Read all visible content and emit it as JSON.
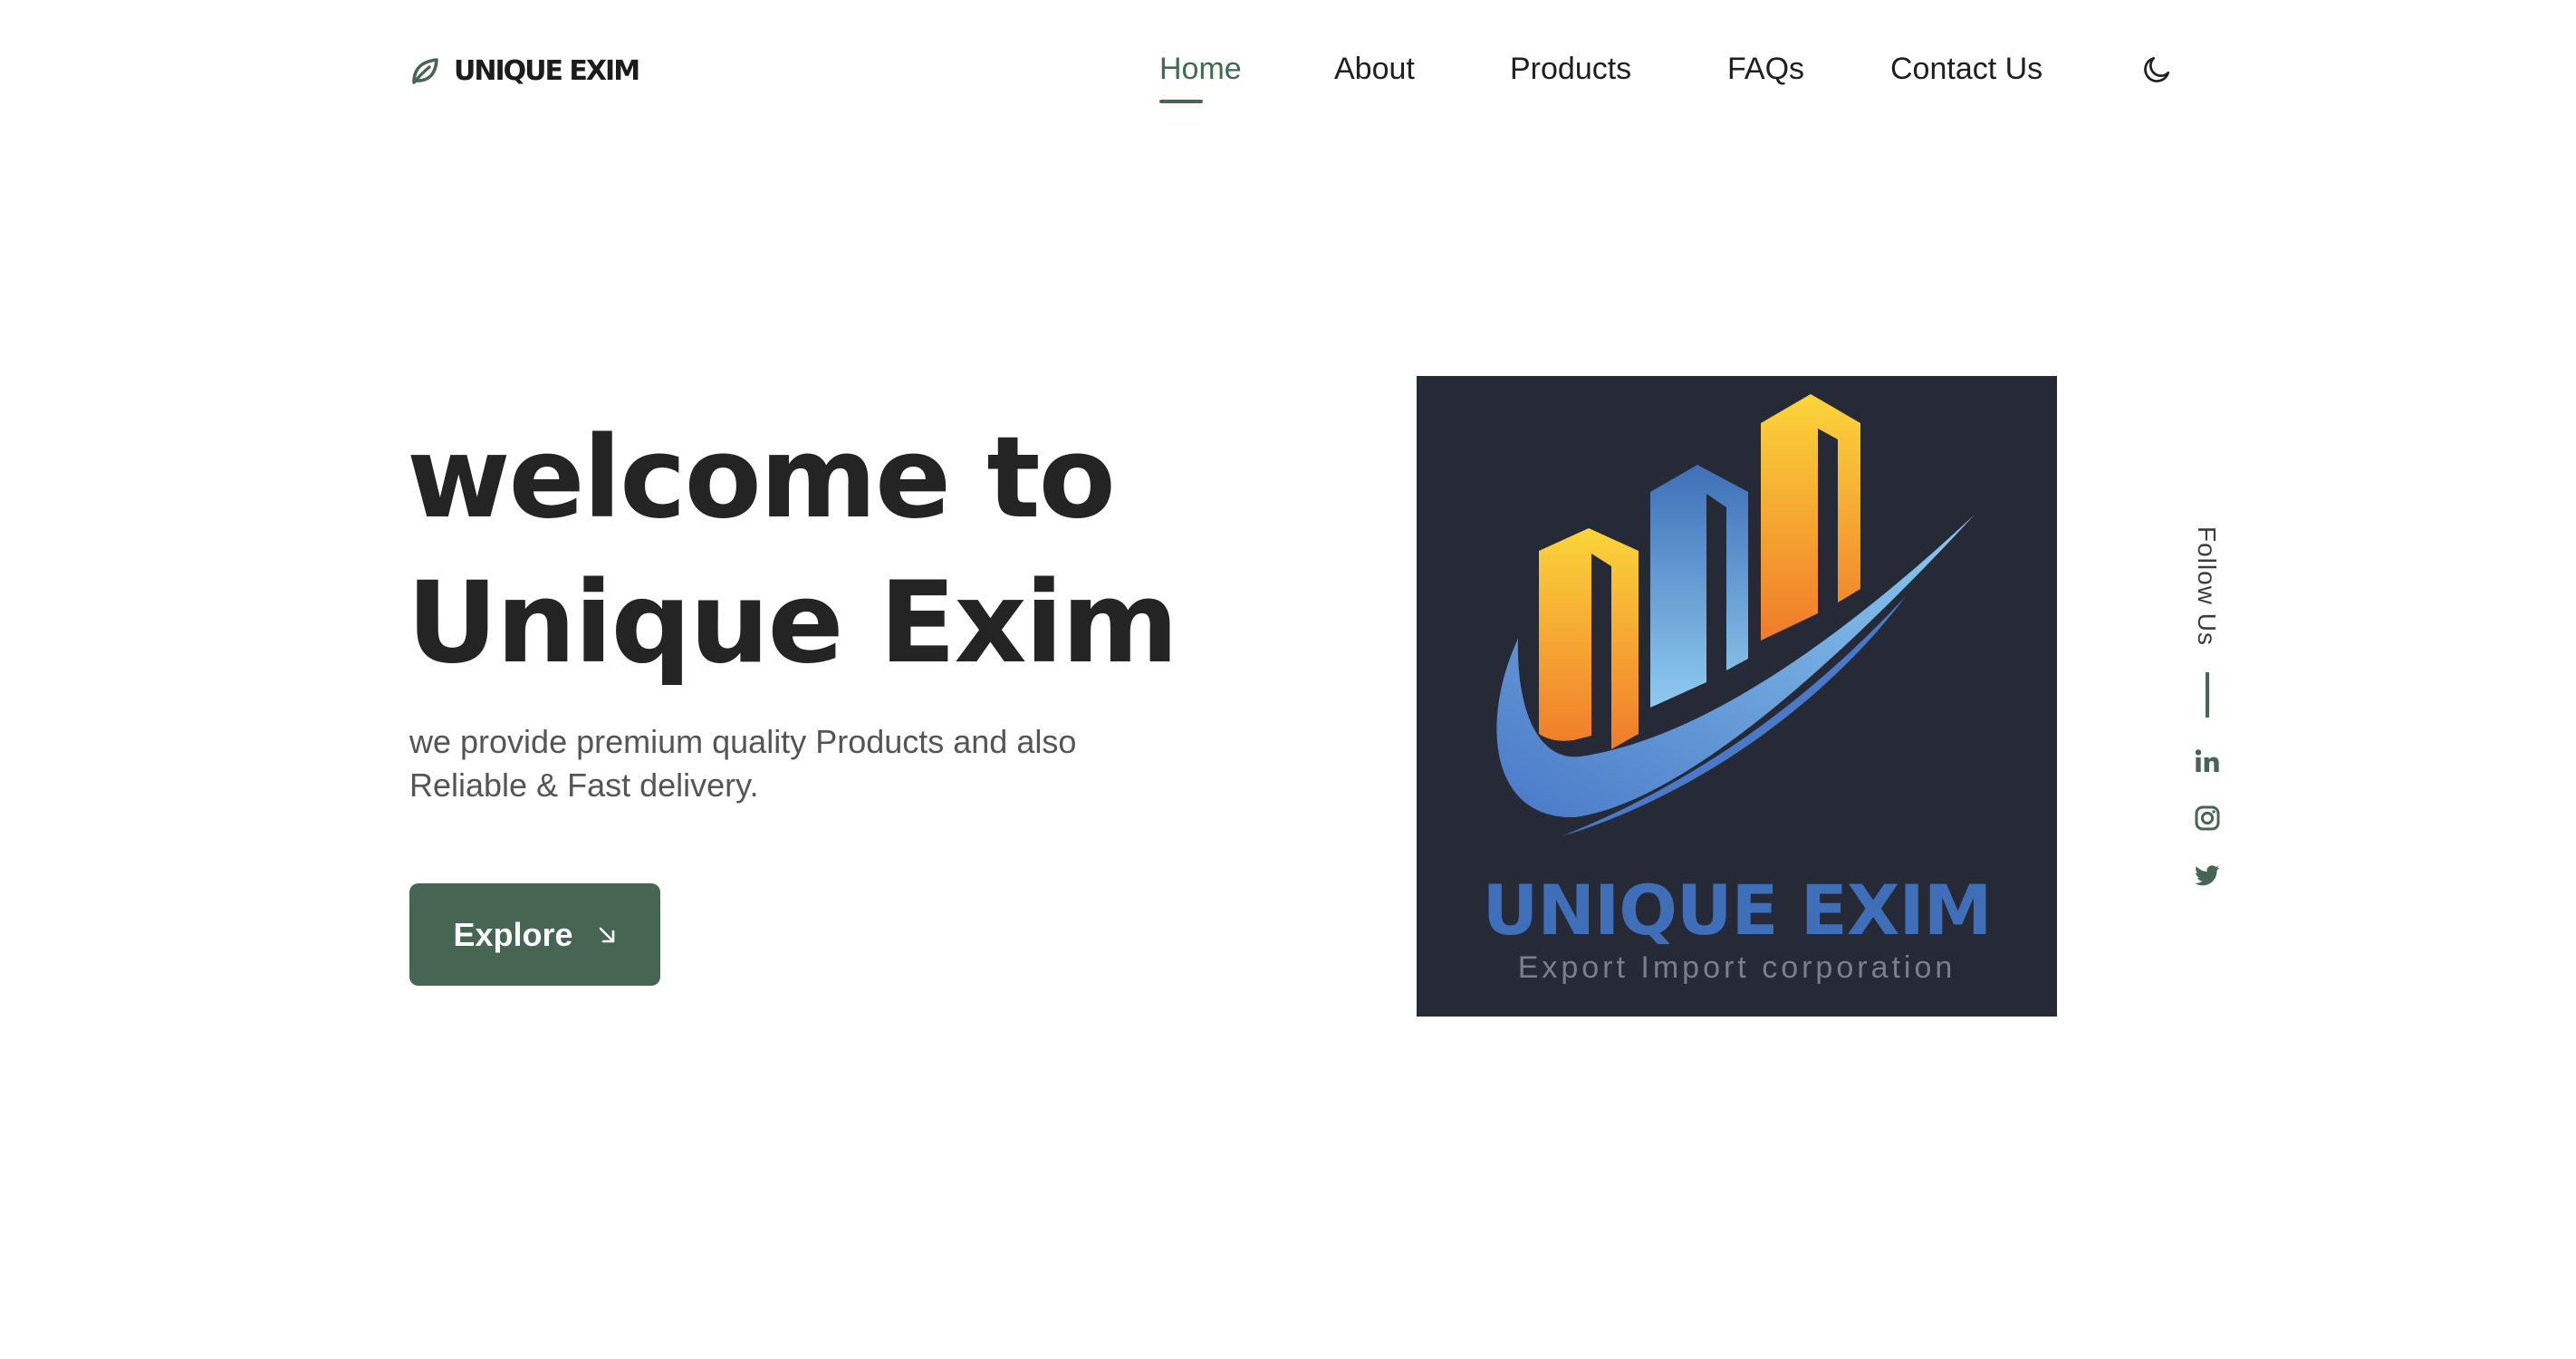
{
  "brand": {
    "name": "UNIQUE EXIM",
    "icon": "leaf-icon"
  },
  "nav": {
    "items": [
      {
        "label": "Home",
        "active": true
      },
      {
        "label": "About",
        "active": false
      },
      {
        "label": "Products",
        "active": false
      },
      {
        "label": "FAQs",
        "active": false
      },
      {
        "label": "Contact Us",
        "active": false
      }
    ],
    "theme_toggle_icon": "moon-icon"
  },
  "hero": {
    "title_line1": "welcome to",
    "title_line2": "Unique Exim",
    "description": "we provide premium quality Products and also Reliable & Fast delivery.",
    "button_label": "Explore",
    "button_icon": "arrow-down-right-icon"
  },
  "hero_image": {
    "logo_title": "UNIQUE EXIM",
    "logo_subtitle": "Export Import corporation"
  },
  "social": {
    "label": "Follow Us",
    "links": [
      "linkedin-icon",
      "instagram-icon",
      "twitter-icon"
    ]
  },
  "colors": {
    "accent": "#476553",
    "active_nav": "#3f6a55",
    "heading": "#242424",
    "body_text": "#555555",
    "logo_background": "#262a37",
    "logo_blue": "#3f6fb8",
    "logo_orange": "#f07b2a",
    "logo_yellow": "#fbd53a"
  }
}
